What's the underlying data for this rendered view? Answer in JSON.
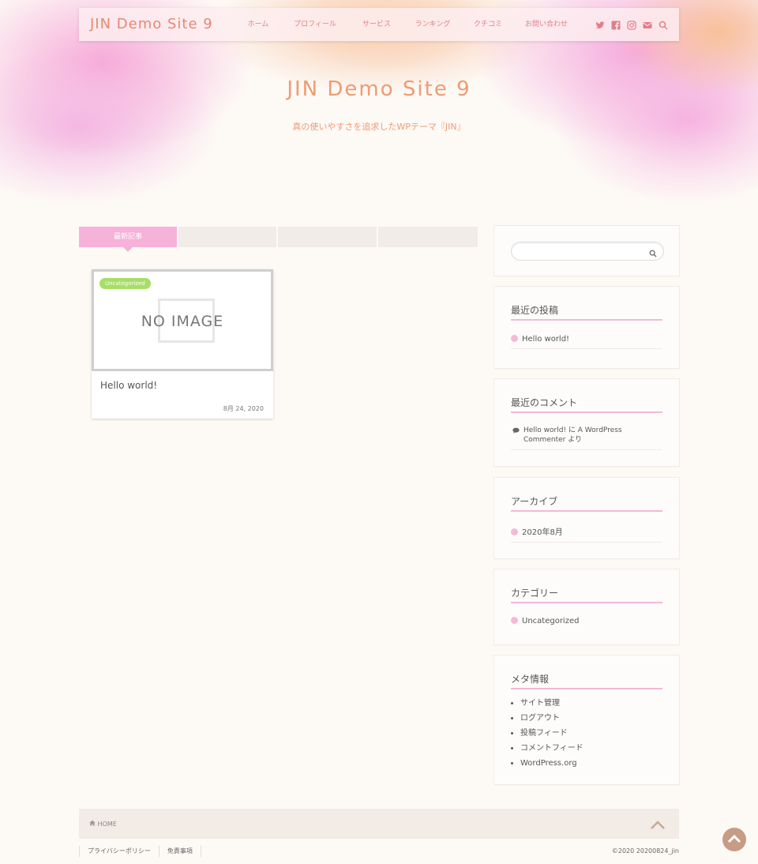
{
  "header": {
    "logo": "JIN Demo Site 9",
    "menu": [
      "ホーム",
      "プロフィール",
      "サービス",
      "ランキング",
      "クチコミ",
      "お問い合わせ"
    ],
    "icons": [
      "twitter-icon",
      "facebook-icon",
      "instagram-icon",
      "mail-icon",
      "search-icon"
    ]
  },
  "hero": {
    "title": "JIN Demo Site 9",
    "tagline": "真の使いやすさを追求したWPテーマ『JIN』"
  },
  "tabs": [
    "最新記事",
    "",
    "",
    ""
  ],
  "post": {
    "category": "Uncategorized",
    "placeholder": "NO IMAGE",
    "title": "Hello world!",
    "date": "8月 24, 2020"
  },
  "sidebar": {
    "recent_posts": {
      "title": "最近の投稿",
      "items": [
        "Hello world!"
      ]
    },
    "recent_comments": {
      "title": "最近のコメント",
      "line1": "Hello world! に A WordPress",
      "line2": "Commenter より"
    },
    "archive": {
      "title": "アーカイブ",
      "items": [
        "2020年8月"
      ]
    },
    "categories": {
      "title": "カテゴリー",
      "items": [
        "Uncategorized"
      ]
    },
    "meta": {
      "title": "メタ情報",
      "items": [
        "サイト管理",
        "ログアウト",
        "投稿フィード",
        "コメントフィード",
        "WordPress.org"
      ]
    }
  },
  "footer": {
    "home": "HOME",
    "links": [
      "プライバシーポリシー",
      "免責事項"
    ],
    "copyright": "©2020  20200824_jin"
  },
  "colors": {
    "accent_pink": "#f7b2d9",
    "title_orange": "#ef9b72",
    "badge_green": "#a7de66"
  }
}
